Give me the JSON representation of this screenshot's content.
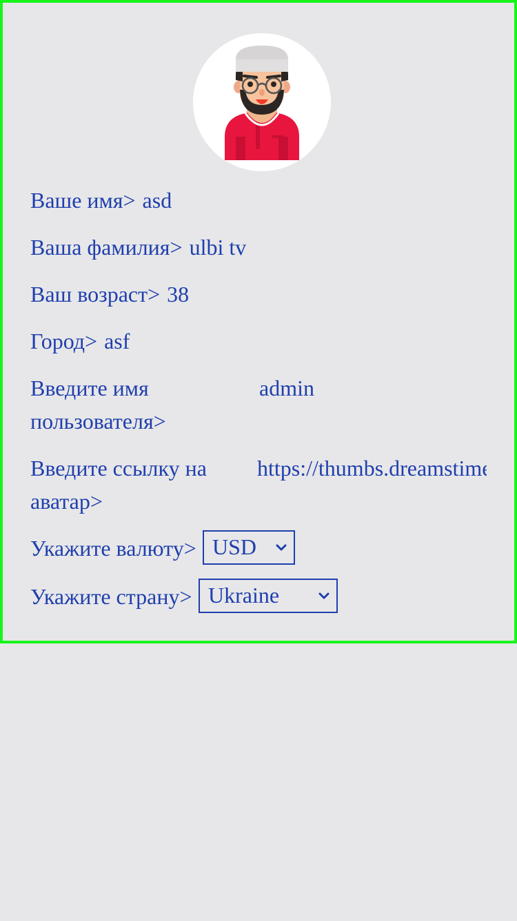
{
  "profile": {
    "avatar_icon": "avatar-man-icon",
    "fields": [
      {
        "label": "Ваше имя>",
        "value": "asd"
      },
      {
        "label": "Ваша фамилия>",
        "value": "ulbi tv"
      },
      {
        "label": "Ваш возраст>",
        "value": "38"
      },
      {
        "label": "Город>",
        "value": "asf"
      }
    ],
    "username": {
      "label": "Введите имя пользователя>",
      "value": "admin"
    },
    "avatar_link": {
      "label": "Введите ссылку на аватар>",
      "value": "https://thumbs.dreamstime"
    },
    "currency": {
      "label": "Укажите валюту>",
      "selected": "USD"
    },
    "country": {
      "label": "Укажите страну>",
      "selected": "Ukraine"
    }
  },
  "colors": {
    "border": "#17f51a",
    "text": "#1f3fad",
    "background": "#e7e7e9"
  }
}
